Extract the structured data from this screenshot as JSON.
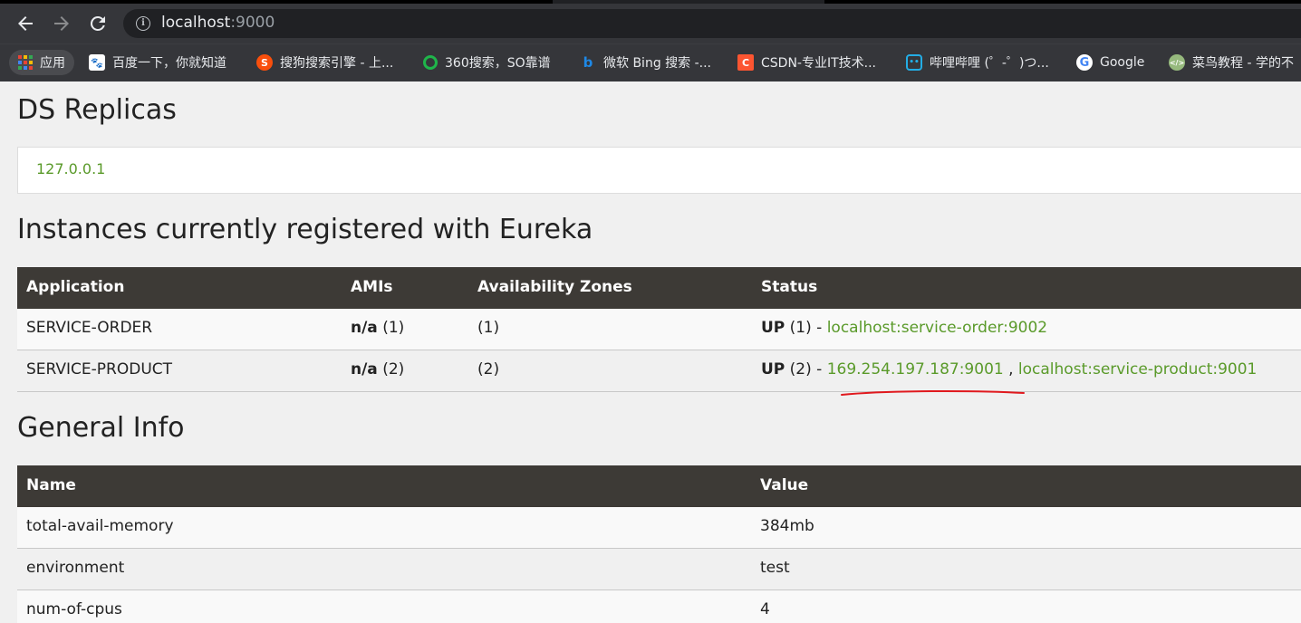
{
  "browser": {
    "back_icon": "arrow-left-icon",
    "forward_icon": "arrow-right-icon",
    "reload_icon": "reload-icon",
    "url_host": "localhost",
    "url_port": ":9000",
    "bookmarks": [
      {
        "label": "应用",
        "icon": "apps-grid-icon"
      },
      {
        "label": "百度一下，你就知道",
        "icon": "baidu-icon",
        "color": "#2932e1"
      },
      {
        "label": "搜狗搜索引擎 - 上...",
        "icon": "sogou-icon",
        "color": "#f94f0c"
      },
      {
        "label": "360搜索，SO靠谱",
        "icon": "360-icon",
        "color": "#1fb54a"
      },
      {
        "label": "微软 Bing 搜索 -...",
        "icon": "bing-icon",
        "color": "#1e88e5"
      },
      {
        "label": "CSDN-专业IT技术...",
        "icon": "csdn-icon",
        "color": "#fc5531"
      },
      {
        "label": "哔哩哔哩 (゜-゜)つ...",
        "icon": "bilibili-icon",
        "color": "#23ade5"
      },
      {
        "label": "Google",
        "icon": "google-icon",
        "color": "#ffffff"
      },
      {
        "label": "菜鸟教程 - 学的不",
        "icon": "runoob-icon",
        "color": "#96b97d"
      }
    ]
  },
  "replicas": {
    "title": "DS Replicas",
    "link": "127.0.0.1"
  },
  "instances": {
    "title": "Instances currently registered with Eureka",
    "headers": [
      "Application",
      "AMIs",
      "Availability Zones",
      "Status"
    ],
    "rows": [
      {
        "application": "SERVICE-ORDER",
        "amis_bold": "n/a",
        "amis_count": " (1)",
        "zones": "(1)",
        "status_bold": "UP",
        "status_count": " (1) - ",
        "link1": "localhost:service-order:9002",
        "separator": "",
        "link2": ""
      },
      {
        "application": "SERVICE-PRODUCT",
        "amis_bold": "n/a",
        "amis_count": " (2)",
        "zones": "(2)",
        "status_bold": "UP",
        "status_count": " (2) - ",
        "link1": "169.254.197.187:9001",
        "separator": " , ",
        "link2": "localhost:service-product:9001"
      }
    ]
  },
  "general": {
    "title": "General Info",
    "headers": [
      "Name",
      "Value"
    ],
    "rows": [
      {
        "name": "total-avail-memory",
        "value": "384mb"
      },
      {
        "name": "environment",
        "value": "test"
      },
      {
        "name": "num-of-cpus",
        "value": "4"
      }
    ]
  },
  "colors": {
    "link": "#5a9a2a",
    "table_header": "#3d3a36",
    "annotation": "#e0191e"
  }
}
